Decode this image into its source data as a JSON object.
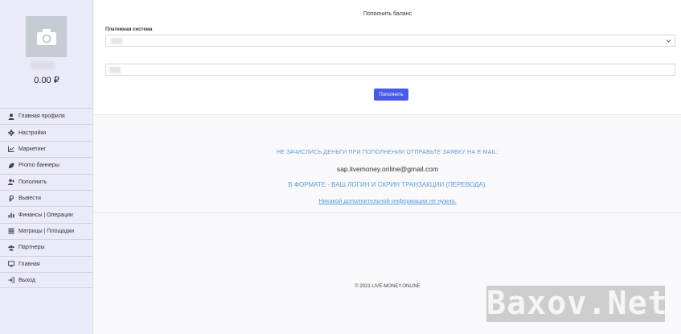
{
  "sidebar": {
    "balance": "0.00 ₽",
    "menu": [
      {
        "label": "Главная профиля",
        "icon": "user-icon"
      },
      {
        "label": "Настройки",
        "icon": "gear-icon"
      },
      {
        "label": "Маркетинг",
        "icon": "line-chart-icon"
      },
      {
        "label": "Promo баннеры",
        "icon": "leaf-icon"
      },
      {
        "label": "Пополнить",
        "icon": "user-plus-icon"
      },
      {
        "label": "Вывести",
        "icon": "ruble-icon"
      },
      {
        "label": "Финансы | Операции",
        "icon": "bar-chart-icon"
      },
      {
        "label": "Матрицы | Площадки",
        "icon": "list-icon"
      },
      {
        "label": "Партнеры",
        "icon": "users-icon"
      },
      {
        "label": "Главная",
        "icon": "desktop-icon"
      },
      {
        "label": "Выход",
        "icon": "sign-out-icon"
      }
    ]
  },
  "form": {
    "title": "Пополнить баланс",
    "payment_label": "Платежная система",
    "submit_label": "Пополнить"
  },
  "notice": {
    "line1": "НЕ ЗАЧИСЛИСЬ ДЕНЬГИ ПРИ ПОПОЛНЕНИИ ОТПРАВЬТЕ ЗАЯВКУ НА E-MAIL:",
    "email": "sap.livemoney.online@gmail.com",
    "line2": "В ФОРМАТЕ - ВАШ ЛОГИН И СКРИН ТРАНЗАКЦИИ (ПЕРЕВОДА).",
    "line3": "Никакой дополнительной информации не нужно."
  },
  "footer": "© 2021 LIVE-MONEY.ONLINE",
  "watermark": "Baxov.Net",
  "colors": {
    "accent": "#4a5ae8",
    "notice_text": "#5a9bd5",
    "sidebar_bg": "#ebeaf8"
  }
}
